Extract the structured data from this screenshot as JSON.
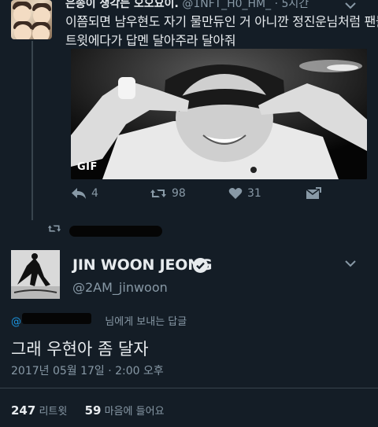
{
  "reply_tweet": {
    "header_name": "은송이 생각는 오오요이.",
    "header_handle": "@1NFT_H0_HM_",
    "header_time": "5시간",
    "text_line1": "이쯤되면 남우현도 자기  물만듀인 거 아니깐 정진운님처럼 팬들",
    "text_line2": "트윗에다가 답멘 달아주라 달아줘",
    "gif_label": "GIF",
    "reply_count": "4",
    "retweet_count": "98",
    "like_count": "31"
  },
  "retweeted_by": {
    "text": ""
  },
  "main_tweet": {
    "display_name": "JIN WOON JEONG",
    "handle": "@2AM_jinwoon",
    "reply_to_prefix": "@",
    "reply_to_suffix": "님에게 보내는 답글",
    "text": "그래 우현아 좀 달자",
    "timestamp": "2017년 05월 17일 · 2:00 오후",
    "retweets_value": "247",
    "retweets_label": "리트윗",
    "likes_value": "59",
    "likes_label": "마음에 들어요"
  },
  "icons": {
    "reply": "reply-icon",
    "retweet": "retweet-icon",
    "like": "heart-icon",
    "dm": "envelope-icon",
    "verified": "verified-icon",
    "chevron": "chevron-down-icon"
  },
  "colors": {
    "background": "#141d26",
    "text": "#e7ebee",
    "muted": "#8899a6",
    "link": "#1b95e0",
    "divider": "#38444d"
  }
}
